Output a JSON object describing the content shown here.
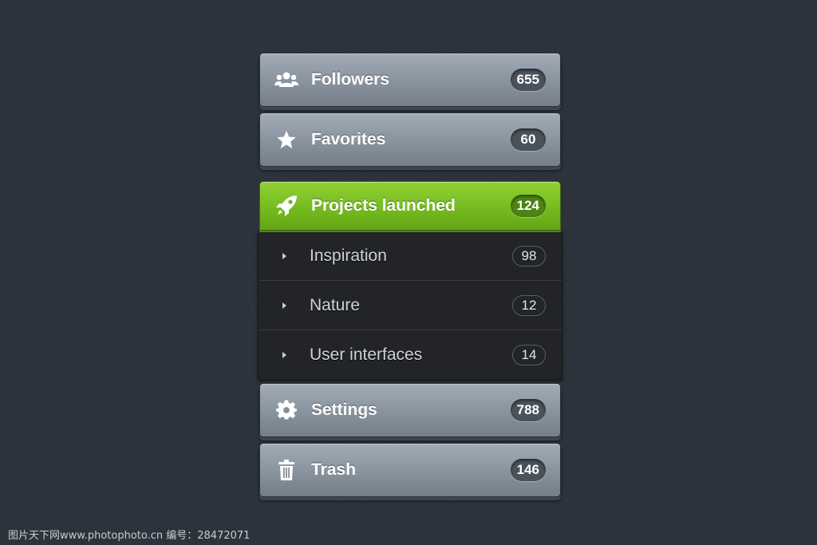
{
  "menu": {
    "followers": {
      "label": "Followers",
      "count": "655",
      "icon": "followers-icon"
    },
    "favorites": {
      "label": "Favorites",
      "count": "60",
      "icon": "star-icon"
    },
    "projects": {
      "label": "Projects launched",
      "count": "124",
      "icon": "rocket-icon",
      "active": true
    },
    "subitems": [
      {
        "label": "Inspiration",
        "count": "98"
      },
      {
        "label": "Nature",
        "count": "12"
      },
      {
        "label": "User interfaces",
        "count": "14"
      }
    ],
    "settings": {
      "label": "Settings",
      "count": "788",
      "icon": "gear-icon"
    },
    "trash": {
      "label": "Trash",
      "count": "146",
      "icon": "trash-icon"
    }
  },
  "watermark": "图片天下网www.photophoto.cn  编号：28472071",
  "colors": {
    "accent": "#78bd22",
    "button": "#8d97a2",
    "background": "#2c333c",
    "submenu": "#222428"
  }
}
